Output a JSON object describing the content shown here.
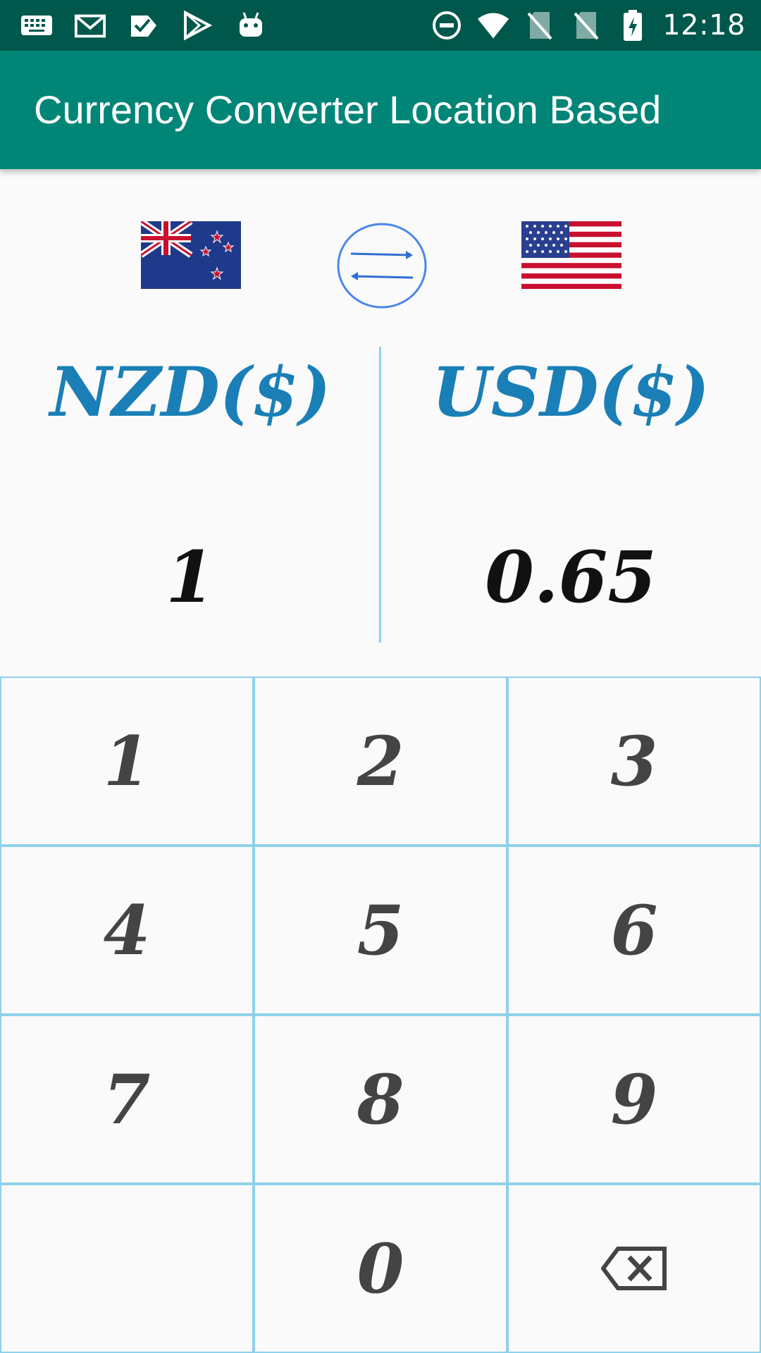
{
  "status_bar": {
    "time": "12:18",
    "left_icons": [
      "keyboard-icon",
      "gmail-icon",
      "tasks-icon",
      "play-store-icon",
      "android-icon"
    ],
    "right_icons": [
      "do-not-disturb-icon",
      "wifi-icon",
      "no-sim-icon",
      "no-sim-2-icon",
      "battery-charging-icon"
    ]
  },
  "app_bar": {
    "title": "Currency Converter Location Based"
  },
  "converter": {
    "from": {
      "flag": "new-zealand-flag",
      "label": "NZD($)",
      "value": "1"
    },
    "to": {
      "flag": "usa-flag",
      "label": "USD($)",
      "value": "0.65"
    },
    "swap_icon": "swap-arrows-icon"
  },
  "keypad": {
    "keys": [
      "1",
      "2",
      "3",
      "4",
      "5",
      "6",
      "7",
      "8",
      "9",
      "",
      "0"
    ],
    "backspace_icon": "backspace-icon"
  },
  "colors": {
    "status_bar": "#00574b",
    "app_bar": "#008577",
    "accent_text": "#1a7fb6",
    "grid_line": "#8fd1ea"
  }
}
